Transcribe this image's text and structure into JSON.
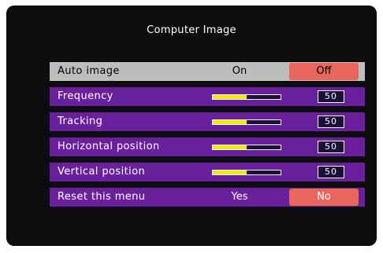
{
  "osd": {
    "title": "Computer Image",
    "rows": [
      {
        "label": "Auto image",
        "on": "On",
        "off": "Off",
        "selected_option": "Off"
      },
      {
        "label": "Frequency",
        "value": "50",
        "level": 0.5
      },
      {
        "label": "Tracking",
        "value": "50",
        "level": 0.5
      },
      {
        "label": "Horizontal position",
        "value": "50",
        "level": 0.5
      },
      {
        "label": "Vertical position",
        "value": "50",
        "level": 0.5
      },
      {
        "label": "Reset this menu",
        "yes": "Yes",
        "no": "No",
        "selected_option": "No"
      }
    ]
  },
  "colors": {
    "screen_bg": "#0d0d10",
    "row_purple": "#6a1f9c",
    "row_selected": "#bdbdbd",
    "selected_option": "#e8675d",
    "slider_fill": "#f2ea00"
  }
}
